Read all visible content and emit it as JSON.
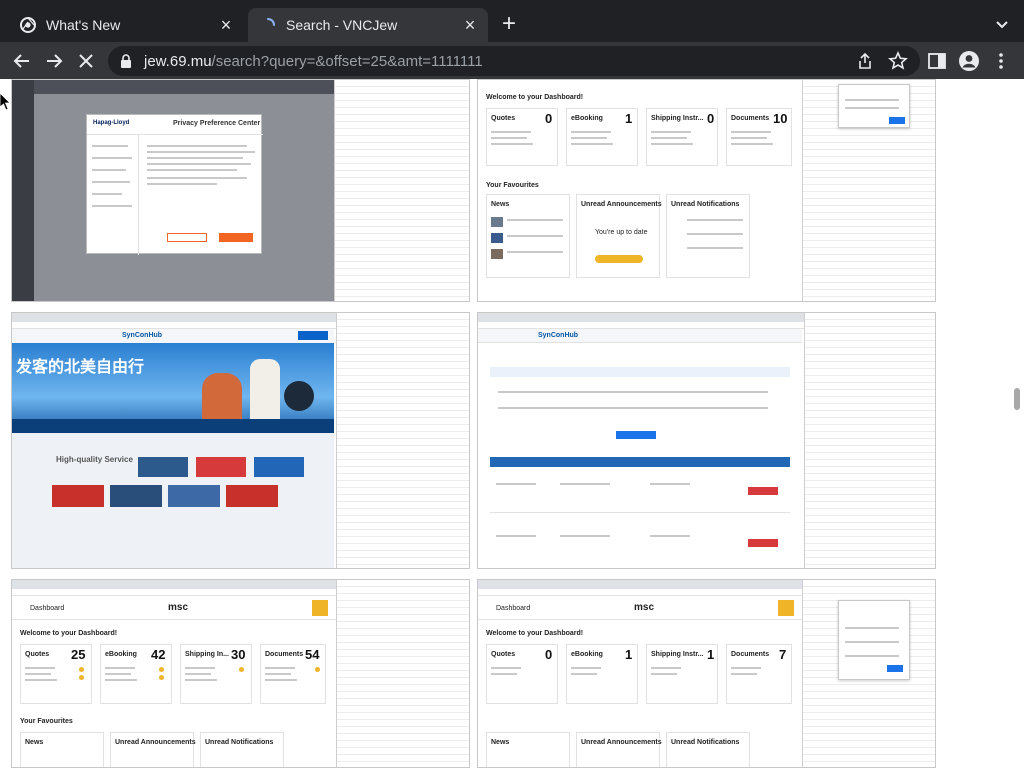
{
  "browser": {
    "tabs": [
      {
        "title": "What's New",
        "active": false
      },
      {
        "title": "Search - VNCJew",
        "active": true
      }
    ],
    "url_host": "jew.69.mu",
    "url_path": "/search?query=&offset=25&amt=1111111"
  },
  "icons": {
    "back": "back-arrow-icon",
    "forward": "forward-arrow-icon",
    "stop": "stop-loading-icon",
    "lock": "lock-icon",
    "share": "share-icon",
    "bookmark": "star-icon",
    "sidepanel": "side-panel-icon",
    "profile": "profile-icon",
    "menu": "kebab-menu-icon"
  },
  "thumbnails": {
    "t1": {
      "privacy_title": "Privacy Preference Center",
      "brand": "Hapag-Lloyd"
    },
    "t2": {
      "welcome": "Welcome to your Dashboard!",
      "cards": [
        {
          "label": "Quotes",
          "value": "0"
        },
        {
          "label": "eBooking",
          "value": "1"
        },
        {
          "label": "Shipping Instr...",
          "value": "0"
        },
        {
          "label": "Documents",
          "value": "10"
        }
      ],
      "favourites": "Your Favourites",
      "panels": [
        "News",
        "Unread Announcements",
        "Unread Notifications"
      ],
      "uptodate": "You're up to date"
    },
    "t3": {
      "banner": "发客的北美自由行",
      "service": "High-quality Service",
      "brand": "SynConHub"
    },
    "t4": {
      "brand": "SynConHub"
    },
    "t5": {
      "header": "Dashboard",
      "welcome": "Welcome to your Dashboard!",
      "cards": [
        {
          "label": "Quotes",
          "value": "25"
        },
        {
          "label": "eBooking",
          "value": "42"
        },
        {
          "label": "Shipping In...",
          "value": "30"
        },
        {
          "label": "Documents",
          "value": "54"
        }
      ],
      "favourites": "Your Favourites",
      "panels": [
        "News",
        "Unread Announcements",
        "Unread Notifications"
      ]
    },
    "t6": {
      "header": "Dashboard",
      "welcome": "Welcome to your Dashboard!",
      "cards": [
        {
          "label": "Quotes",
          "value": "0"
        },
        {
          "label": "eBooking",
          "value": "1"
        },
        {
          "label": "Shipping Instr...",
          "value": "1"
        },
        {
          "label": "Documents",
          "value": "7"
        }
      ],
      "panels": [
        "News",
        "Unread Announcements",
        "Unread Notifications"
      ]
    }
  },
  "colors": {
    "chrome_dark": "#202124",
    "chrome_tab": "#35363a",
    "hapag_orange": "#f26522",
    "msc_yellow": "#f0b429"
  }
}
